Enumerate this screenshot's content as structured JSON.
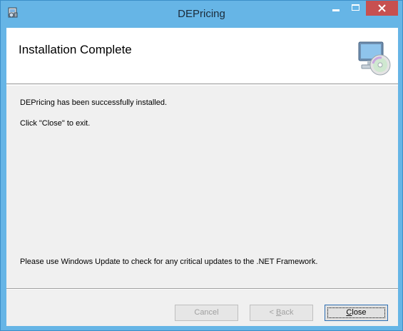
{
  "window": {
    "title": "DEPricing",
    "app_icon": "installer-icon",
    "controls": {
      "minimize_icon": "minimize-icon",
      "maximize_icon": "maximize-icon",
      "close_icon": "close-icon"
    },
    "accent_color": "#66b5e6",
    "close_color": "#c75050"
  },
  "banner": {
    "title": "Installation Complete",
    "icon": "computer-cd-icon"
  },
  "body": {
    "message1": "DEPricing has been successfully installed.",
    "message2": "Click \"Close\" to exit.",
    "message3": "Please use Windows Update to check for any critical updates to the .NET Framework."
  },
  "buttons": {
    "cancel": {
      "label": "Cancel",
      "enabled": false
    },
    "back": {
      "mnemonic": "B",
      "rest": "ack",
      "prefix": "< ",
      "enabled": false
    },
    "close": {
      "mnemonic": "C",
      "rest": "lose",
      "enabled": true
    }
  }
}
